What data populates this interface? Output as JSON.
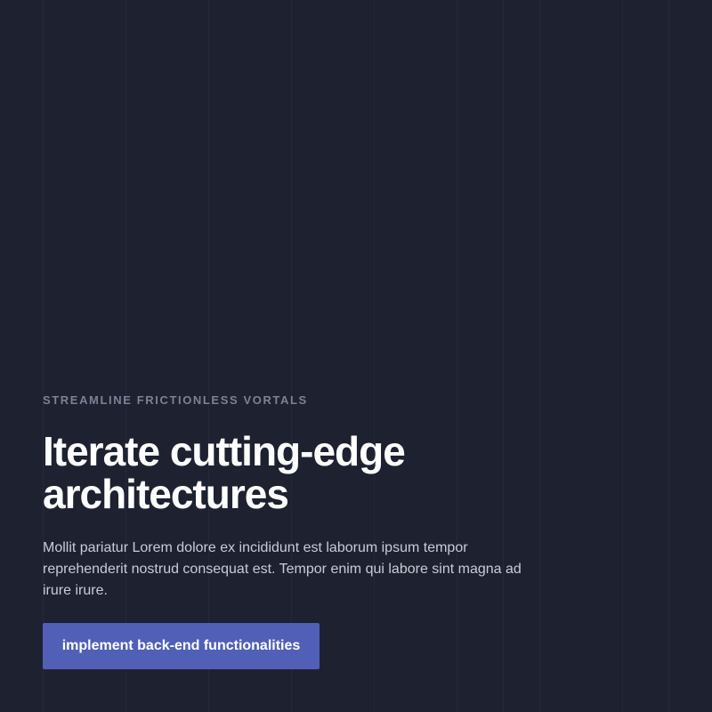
{
  "hero": {
    "eyebrow": "STREAMLINE FRICTIONLESS VORTALS",
    "headline": "Iterate cutting-edge architectures",
    "body": "Mollit pariatur Lorem dolore ex incididunt est laborum ipsum tempor reprehenderit nostrud consequat est. Tempor enim qui labore sint magna ad irure irure.",
    "cta_label": "implement back-end functionalities"
  },
  "colors": {
    "background": "#1e2130",
    "accent": "#5160b6",
    "eyebrow": "#7b8294",
    "headline": "#ffffff",
    "body": "#c9ccd5"
  }
}
